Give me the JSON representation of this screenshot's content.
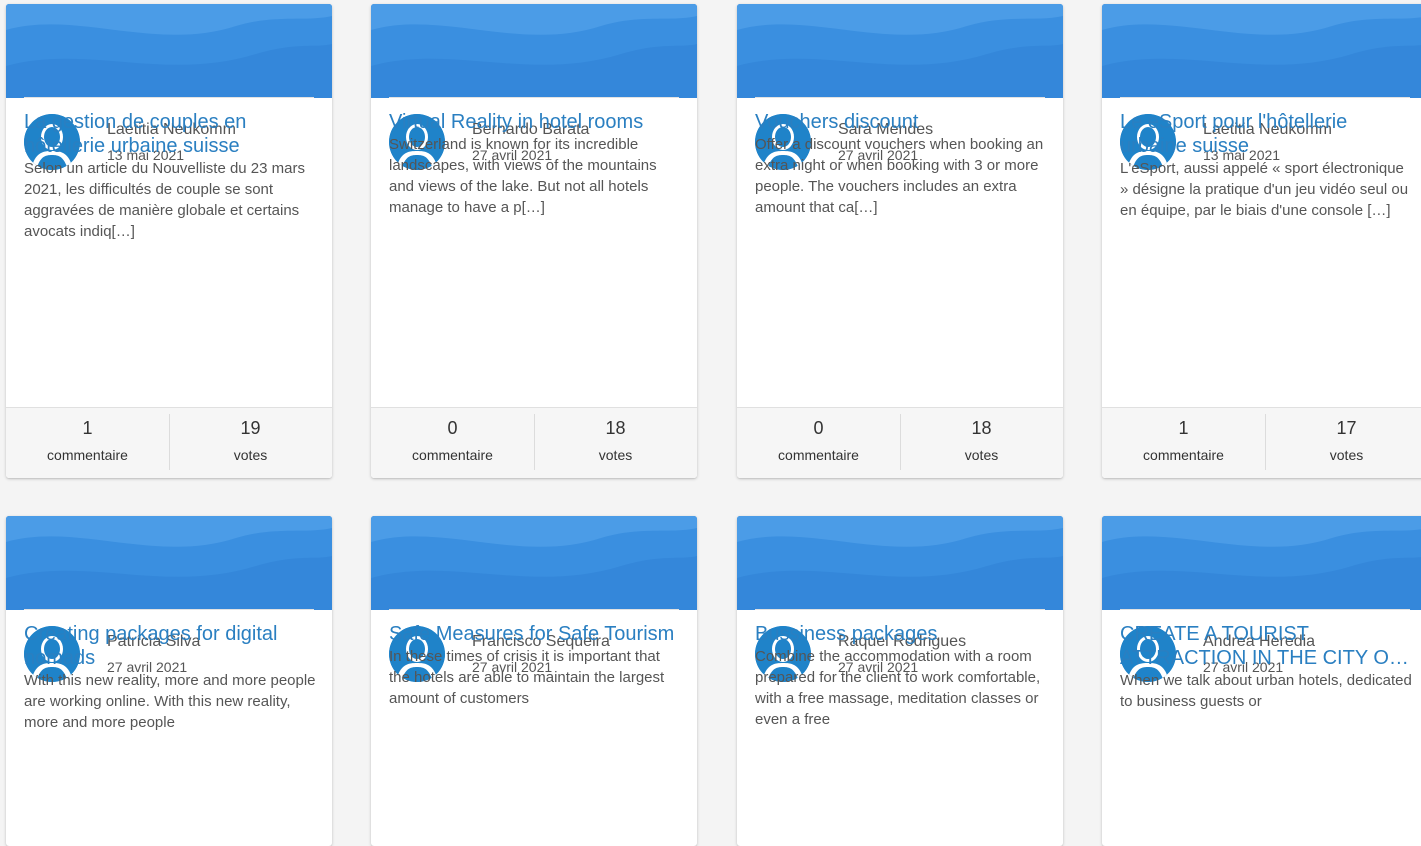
{
  "colors": {
    "banner_base": "#3a8fe0",
    "title": "#2a7fc1",
    "avatar": "#1f83c9",
    "text": "#555555",
    "background": "#f4f4f4"
  },
  "icons": {
    "avatar": "user-silhouette-icon",
    "banner": "wave-background"
  },
  "cards": [
    {
      "author": "Laetitia Neukomm",
      "date": "13 mai 2021",
      "title": "La gestion de couples en hôtellerie urbaine suisse",
      "excerpt": "Selon un article du Nouvelliste du 23 mars 2021, les difficultés de couple se sont aggravées de manière globale et certains avocats indiq[…]",
      "comments_count": "1",
      "comments_label": "commentaire",
      "votes_count": "19",
      "votes_label": "votes"
    },
    {
      "author": "Bernardo Barata",
      "date": "27 avril 2021",
      "title": "Virtual Reality in hotel rooms",
      "excerpt": "Switzerland is known for its incredible landscapes, with views of the mountains and views of the lake. But not all hotels manage to have a p[…]",
      "comments_count": "0",
      "comments_label": "commentaire",
      "votes_count": "18",
      "votes_label": "votes"
    },
    {
      "author": "Sara Mendes",
      "date": "27 avril 2021",
      "title": "Vouchers discount",
      "excerpt": "Offer a discount vouchers when booking an extra night or when booking with 3 or more people. The vouchers includes an extra amount that ca[…]",
      "comments_count": "0",
      "comments_label": "commentaire",
      "votes_count": "18",
      "votes_label": "votes"
    },
    {
      "author": "Laetitia Neukomm",
      "date": "13 mai 2021",
      "title": "Le eSport pour l'hôtellerie urbaine suisse",
      "excerpt": "L'eSport, aussi appelé « sport électronique » désigne la pratique d'un jeu vidéo seul ou en équipe, par le biais d'une console […]",
      "comments_count": "1",
      "comments_label": "commentaire",
      "votes_count": "17",
      "votes_label": "votes"
    },
    {
      "author": "Patrícia Silva",
      "date": "27 avril 2021",
      "title": "Creating packages for digital nomads",
      "excerpt": "With this new reality, more and more people are working online. With this new reality, more and more people"
    },
    {
      "author": "Francisco Sequeira",
      "date": "27 avril 2021",
      "title": "Safe Measures for Safe Tourism",
      "excerpt": "In these times of crisis it is important that the hotels are able to maintain the largest amount of customers"
    },
    {
      "author": "Raquel Rodrigues",
      "date": "27 avril 2021",
      "title": "Bussiness packages",
      "excerpt": "Combine the accommodation with a room prepared for the client to work comfortable, with a free massage, meditation classes or even a free"
    },
    {
      "author": "Andrea Heredia",
      "date": "27 avril 2021",
      "title": "CREATE A TOURIST ATTRACTION IN THE CITY OF HOTELS WITH THE S...",
      "excerpt": "When we talk about urban hotels, dedicated to business guests or"
    }
  ]
}
